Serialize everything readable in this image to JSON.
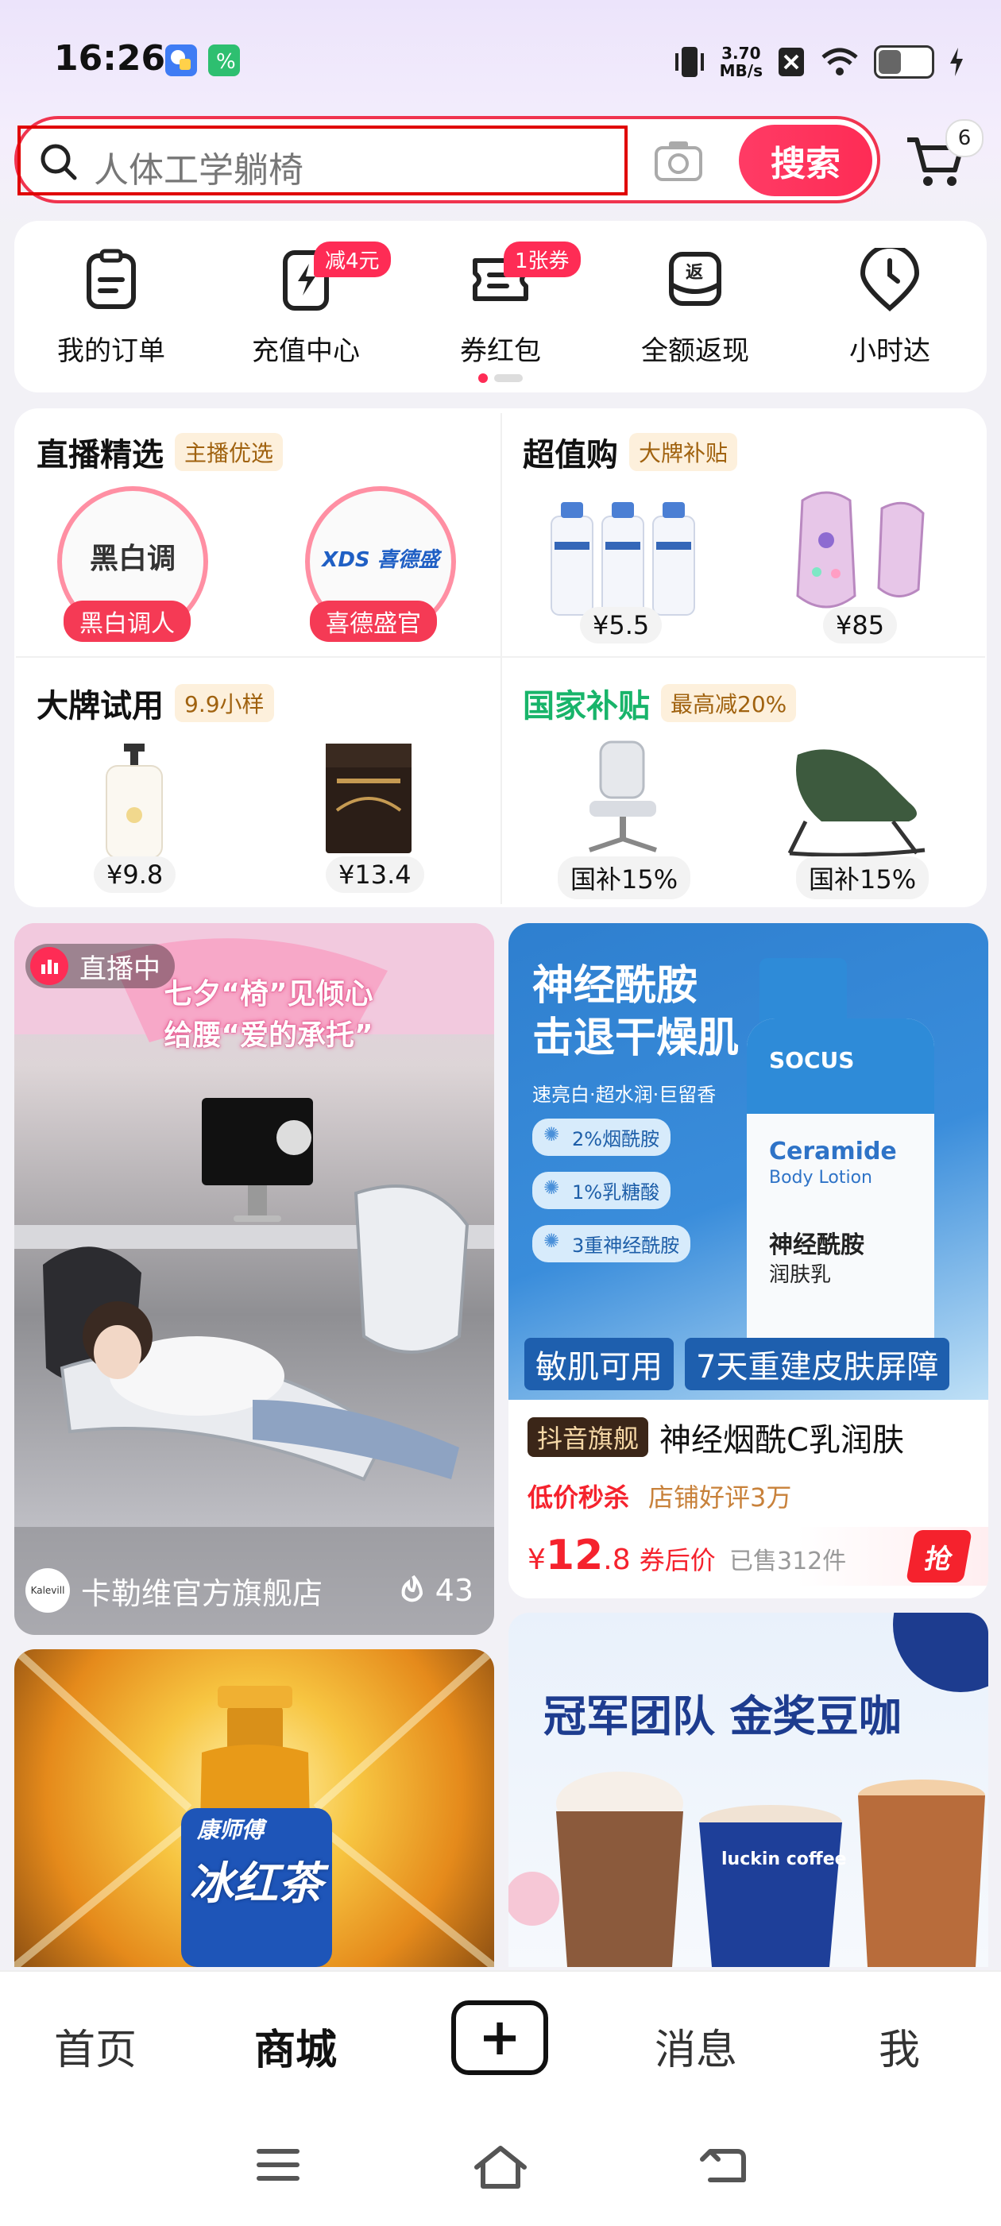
{
  "status_bar": {
    "time": "16:26",
    "net_speed_value": "3.70",
    "net_speed_unit": "MB/s"
  },
  "search": {
    "query": "人体工学躺椅",
    "button_label": "搜索",
    "cart_count": "6"
  },
  "shortcuts": [
    {
      "label": "我的订单",
      "icon": "clipboard-icon",
      "badge": ""
    },
    {
      "label": "充值中心",
      "icon": "phone-lightning-icon",
      "badge": "减4元"
    },
    {
      "label": "券红包",
      "icon": "coupon-icon",
      "badge": "1张券"
    },
    {
      "label": "全额返现",
      "icon": "cashback-icon",
      "badge": ""
    },
    {
      "label": "小时达",
      "icon": "clock-pin-icon",
      "badge": ""
    }
  ],
  "channels": {
    "live": {
      "title": "直播精选",
      "tag": "主播优选",
      "items": [
        {
          "name": "黑白调",
          "label": "黑白调人"
        },
        {
          "name": "XDS 喜德盛",
          "label": "喜德盛官"
        }
      ]
    },
    "deals": {
      "title": "超值购",
      "tag": "大牌补贴",
      "prices": [
        "¥5.5",
        "¥85"
      ]
    },
    "trial": {
      "title": "大牌试用",
      "tag": "9.9小样",
      "prices": [
        "¥9.8",
        "¥13.4"
      ]
    },
    "subsidy": {
      "title": "国家补贴",
      "tag": "最高减20%",
      "prices": [
        "国补15%",
        "国补15%"
      ]
    }
  },
  "feed": {
    "card1": {
      "live_badge": "直播中",
      "banner_line1": "七夕“椅”见倾心",
      "banner_line2": "给腰“爱的承托”",
      "shop": "卡勒维官方旗舰店",
      "heat": "43"
    },
    "card2": {
      "headline1": "神经酰胺",
      "headline2": "击退干燥肌",
      "subline": "速亮白·超水润·巨留香",
      "chips": [
        "2%烟酰胺",
        "1%乳糖酸",
        "3重神经酰胺"
      ],
      "bottle_brand": "SOCUS",
      "bottle_name": "Ceramide",
      "bottle_sub": "Body Lotion",
      "bottle_cn": "神经酰胺",
      "bottle_cn2": "润肤乳",
      "strip_left": "敏肌可用",
      "strip_right": "7天重建皮肤屏障",
      "store_tag": "抖音旗舰",
      "title": "神经烟酰C乳润肤",
      "flash": "低价秒杀",
      "rating": "店铺好评3万",
      "price_symbol": "¥",
      "price_int": "12",
      "price_dec": ".8",
      "price_note": "券后价",
      "sold": "已售312件",
      "grab": "抢"
    },
    "card3": {
      "brand": "康师傅",
      "product": "冰红茶"
    },
    "card4": {
      "headline": "冠军团队 金奖豆咖",
      "cup_brand": "luckin coffee"
    }
  },
  "bottom_nav": [
    "首页",
    "商城",
    "+",
    "消息",
    "我"
  ],
  "colors": {
    "accent": "#fe2c55",
    "price": "#f5222d"
  }
}
